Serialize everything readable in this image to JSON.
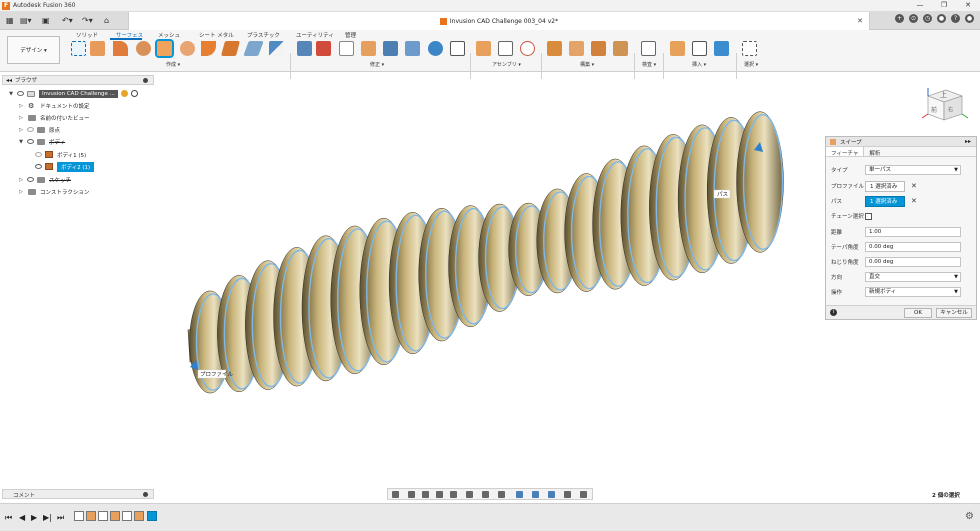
{
  "window": {
    "app_title": "Autodesk Fusion 360",
    "document_title": "Invusion CAD Challenge 003_04 v2*"
  },
  "workspace": {
    "label": "デザイン ▾"
  },
  "ribbon": {
    "tabs": [
      {
        "label": "ソリッド"
      },
      {
        "label": "サーフェス",
        "active": true
      },
      {
        "label": "メッシュ"
      },
      {
        "label": "シート メタル"
      },
      {
        "label": "プラスチック"
      },
      {
        "label": "ユーティリティ"
      },
      {
        "label": "管理"
      }
    ],
    "groups": [
      {
        "label": "作成 ▾"
      },
      {
        "label": "修正 ▾"
      },
      {
        "label": "アセンブリ ▾"
      },
      {
        "label": "構築 ▾"
      },
      {
        "label": "検査 ▾"
      },
      {
        "label": "挿入 ▾"
      },
      {
        "label": "選択 ▾"
      }
    ]
  },
  "browser": {
    "title": "ブラウザ",
    "nodes": [
      {
        "label": "Invusion CAD Challenge ..."
      },
      {
        "label": "ドキュメントの設定"
      },
      {
        "label": "名前の付いたビュー"
      },
      {
        "label": "原点"
      },
      {
        "label": "ボディ"
      },
      {
        "label": "ボディ1 (5)"
      },
      {
        "label": "ボディ2 (1)"
      },
      {
        "label": "スケッチ"
      },
      {
        "label": "コンストラクション"
      }
    ]
  },
  "viewport": {
    "profile_label": "プロファイル",
    "path_label": "パス"
  },
  "sweep_panel": {
    "title": "スイープ",
    "tabs": [
      "フィーチャ",
      "解析"
    ],
    "type_label": "タイプ",
    "type_value": "単一パス",
    "profile_label": "プロファイル",
    "profile_value": "1 選択済み",
    "path_label": "パス",
    "path_value": "1 選択済み",
    "chain_label": "チェーン選択",
    "distance_label": "距離",
    "distance_value": "1.00",
    "taper_label": "テーパ角度",
    "taper_value": "0.00 deg",
    "twist_label": "ねじり角度",
    "twist_value": "0.00 deg",
    "orientation_label": "方向",
    "orientation_value": "直交",
    "operation_label": "操作",
    "operation_value": "新規ボディ",
    "ok_label": "OK",
    "cancel_label": "キャンセル"
  },
  "bottom": {
    "comments_label": "コメント",
    "selection_count": "2 個の選択"
  },
  "colors": {
    "accent": "#0696d7",
    "surface_tan": "#c9b47a",
    "edge_highlight": "#7fb8e6"
  }
}
